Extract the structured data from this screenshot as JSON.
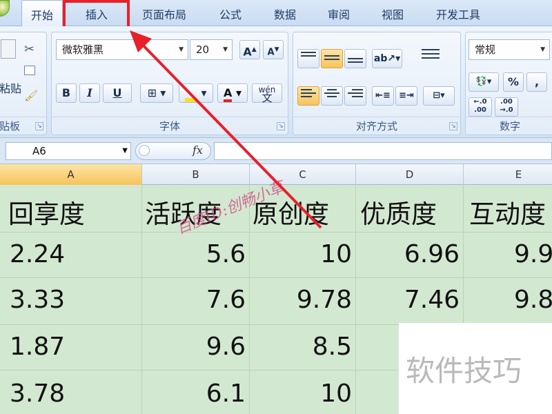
{
  "tabs": [
    {
      "label": "开始"
    },
    {
      "label": "插入"
    },
    {
      "label": "页面布局"
    },
    {
      "label": "公式"
    },
    {
      "label": "数据"
    },
    {
      "label": "审阅"
    },
    {
      "label": "视图"
    },
    {
      "label": "开发工具"
    }
  ],
  "ribbon": {
    "clipboard": {
      "paste_label": "粘贴",
      "group_label": "贴板"
    },
    "font": {
      "name": "微软雅黑",
      "size": "20",
      "bold": "B",
      "italic": "I",
      "underline": "U",
      "wen": "wén",
      "wen_char": "文",
      "group_label": "字体"
    },
    "alignment": {
      "group_label": "对齐方式"
    },
    "number": {
      "format": "常规",
      "percent": "%",
      "comma": ",",
      "group_label": "数字",
      "inc_dec": ".0\n.00"
    }
  },
  "formula_bar": {
    "name_box": "A6",
    "fx": "fx",
    "value": ""
  },
  "columns": [
    {
      "label": "A"
    },
    {
      "label": "B"
    },
    {
      "label": "C"
    },
    {
      "label": "D"
    },
    {
      "label": "E"
    }
  ],
  "rows": [
    [
      "回享度",
      "活跃度",
      "原创度",
      "优质度",
      "互动度"
    ],
    [
      "2.24",
      "5.6",
      "10",
      "6.96",
      "9.9"
    ],
    [
      "3.33",
      "7.6",
      "9.78",
      "7.46",
      "9.8"
    ],
    [
      "1.87",
      "9.6",
      "8.5",
      "",
      ""
    ],
    [
      "3.78",
      "6.1",
      "10",
      "",
      ""
    ]
  ],
  "watermark": "百度ID:创畅小草",
  "brand_overlay": "软件技巧",
  "colors": {
    "highlight": "#e8202a",
    "cell_fill": "#d3e8d0",
    "selected_tab": "#ffffff"
  }
}
